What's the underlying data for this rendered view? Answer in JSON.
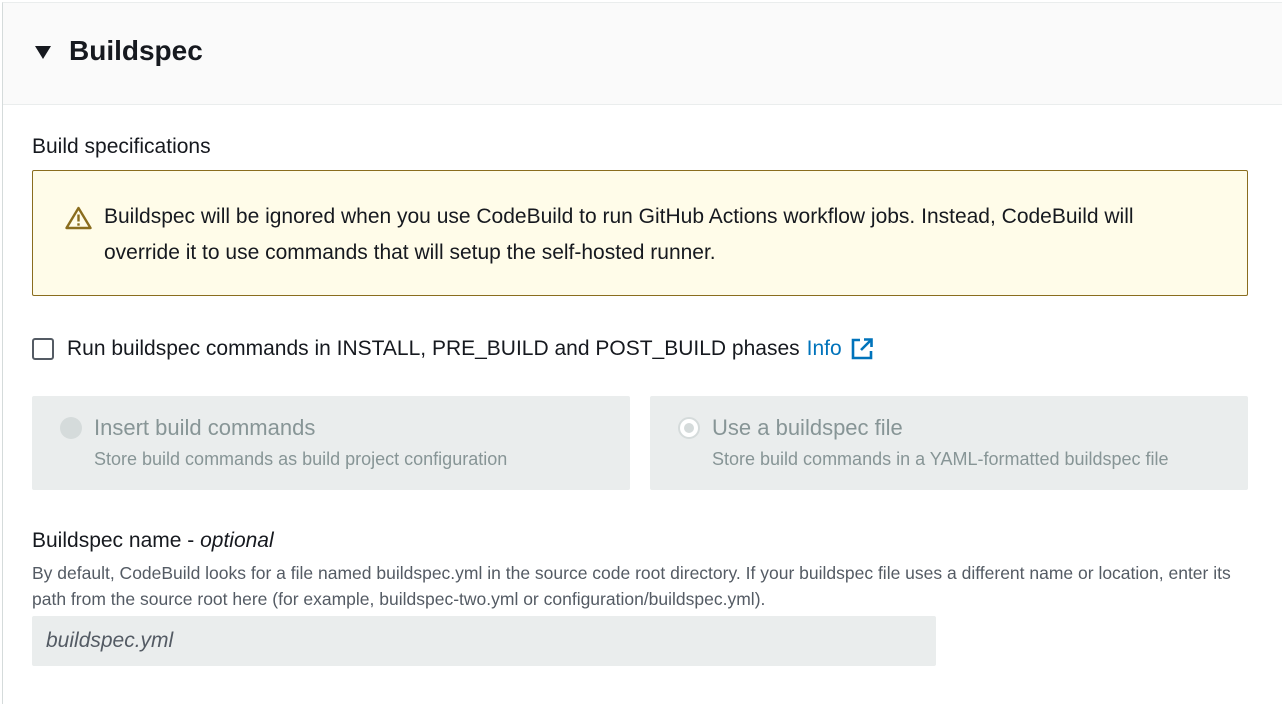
{
  "panel": {
    "title": "Buildspec"
  },
  "section": {
    "label": "Build specifications"
  },
  "alert": {
    "icon": "warning-icon",
    "text": "Buildspec will be ignored when you use CodeBuild to run GitHub Actions workflow jobs. Instead, CodeBuild will override it to use commands that will setup the self-hosted runner."
  },
  "checkbox": {
    "label": "Run buildspec commands in INSTALL, PRE_BUILD and POST_BUILD phases",
    "checked": false,
    "info_label": "Info",
    "info_icon": "external-link-icon"
  },
  "build_options": [
    {
      "title": "Insert build commands",
      "description": "Store build commands as build project configuration",
      "selected": false,
      "disabled": true
    },
    {
      "title": "Use a buildspec file",
      "description": "Store build commands in a YAML-formatted buildspec file",
      "selected": true,
      "disabled": true
    }
  ],
  "buildspec_name": {
    "label": "Buildspec name - ",
    "label_optional": "optional",
    "description": "By default, CodeBuild looks for a file named buildspec.yml in the source code root directory. If your buildspec file uses a different name or location, enter its path from the source root here (for example, buildspec-two.yml or configuration/buildspec.yml).",
    "placeholder": "buildspec.yml"
  },
  "colors": {
    "link": "#0073bb",
    "alert_bg": "#fffce9",
    "alert_border": "#8a6d1e",
    "disabled_bg": "#eaeded"
  }
}
